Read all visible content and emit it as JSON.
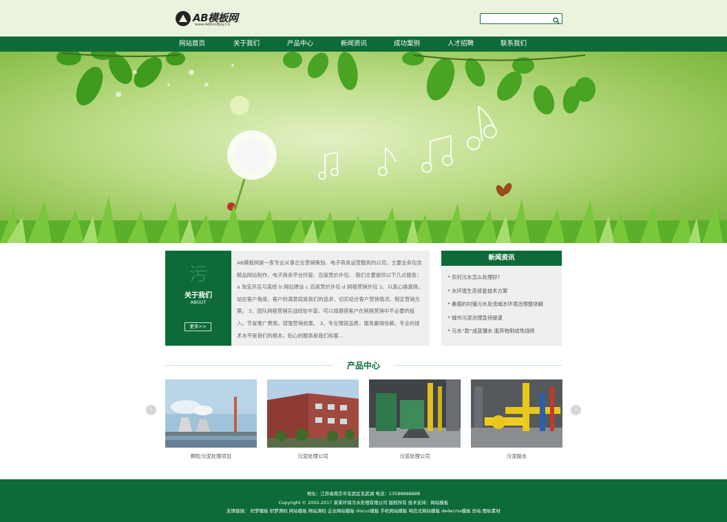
{
  "header": {
    "logo_text": "AB模板网",
    "logo_sub": "www.AdminBuy.Cn",
    "search_placeholder": ""
  },
  "nav": {
    "items": [
      "网站首页",
      "关于我们",
      "产品中心",
      "新闻资讯",
      "成功案例",
      "人才招聘",
      "联系我们"
    ]
  },
  "banner": {
    "slide_count": 3,
    "active_slide": 1
  },
  "about": {
    "char": "污",
    "title": "关于我们",
    "subtitle": "ABOUT",
    "more": "更多>>",
    "text": "AB模板网是一家专业从事企业营销策划、电子商务运营服务的公司，主要业务包含精品网站制作、电子商务平台托管、百度竞价外包、 我们主要提供以下几点服务： a 淘宝开店与装修 b 网站建设 c 百度竞价外包 d 网络营销外包 1、以真心换真情，站在客户角度，客户的满意就是我们的追求，切实结合客户营销情况，制定营销方案。 2、团队网络营销实战经验丰富，可以规避很客户在网络营销中不必要的投入。节省推广费用，增强营销效果。 3、专业铸就品质，服务赢得信赖。专业的技术水平是我们的根本，贴心的服务是我们和客..."
  },
  "news": {
    "title": "新闻资讯",
    "items": [
      "农村污水怎么处理好?",
      "水环境生态修复技术方案",
      "桑德的村镇污水及流域水环境治理整体解",
      "城市污泥治理急待提速",
      "污水“款”成蓝镶水 废弃物制成免烧砖"
    ]
  },
  "products": {
    "title": "产品中心",
    "prev": "‹",
    "next": "›",
    "items": [
      {
        "caption": "颗粒污泥处理项目",
        "icon": "power-plant-photo"
      },
      {
        "caption": "污泥处理公司",
        "icon": "factory-building-photo"
      },
      {
        "caption": "污泥处理公司",
        "icon": "industrial-machine-photo"
      },
      {
        "caption": "污泥脱水",
        "icon": "yellow-pipes-photo"
      }
    ]
  },
  "footer": {
    "line1": "地址：江苏省南京市玄武区玄武湖  电话：13588888888",
    "line2": "Copyright © 2002-2017 某某环保污水处理有限公司 版权所有  技术支持：网站模板",
    "line3": "友情链接： 织梦模板 织梦源码 网站模板 网站源码 企业网站模板 discuz模板 手机网站模板 响应式网站模板 dedecms模板 仿站 图标素材"
  },
  "colors": {
    "brand_green": "#0e6b39",
    "header_bg": "#ebf3dc"
  }
}
